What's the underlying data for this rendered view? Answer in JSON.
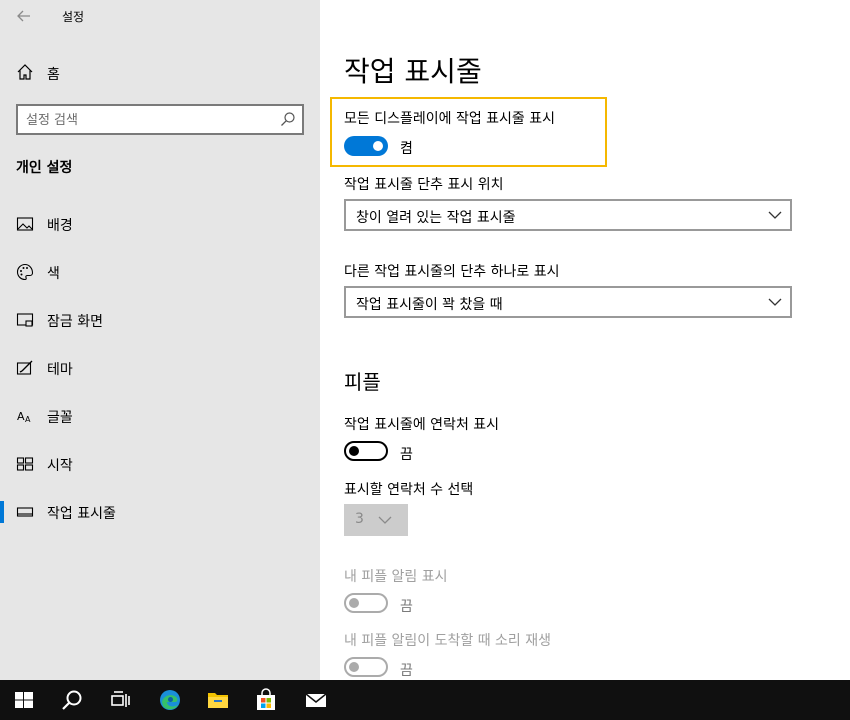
{
  "window": {
    "title": "설정"
  },
  "sidebar": {
    "home_label": "홈",
    "search_placeholder": "설정 검색",
    "section_label": "개인 설정",
    "items": [
      {
        "label": "배경",
        "icon": "picture-icon"
      },
      {
        "label": "색",
        "icon": "palette-icon"
      },
      {
        "label": "잠금 화면",
        "icon": "lock-screen-icon"
      },
      {
        "label": "테마",
        "icon": "theme-icon"
      },
      {
        "label": "글꼴",
        "icon": "font-icon"
      },
      {
        "label": "시작",
        "icon": "start-icon"
      },
      {
        "label": "작업 표시줄",
        "icon": "taskbar-icon",
        "active": true
      }
    ]
  },
  "main": {
    "title": "작업 표시줄",
    "all_displays": {
      "label": "모든 디스플레이에 작업 표시줄 표시",
      "state": "켬",
      "on": true
    },
    "button_position": {
      "label": "작업 표시줄 단추 표시 위치",
      "value": "창이 열려 있는 작업 표시줄"
    },
    "combine_buttons": {
      "label": "다른 작업 표시줄의 단추 하나로 표시",
      "value": "작업 표시줄이 꽉 찼을 때"
    },
    "people": {
      "heading": "피플",
      "show_contacts": {
        "label": "작업 표시줄에 연락처 표시",
        "state": "끔",
        "on": false
      },
      "contact_count": {
        "label": "표시할 연락처 수 선택",
        "value": "3"
      },
      "show_notifications": {
        "label": "내 피플 알림 표시",
        "state": "끔",
        "on": false,
        "disabled": true
      },
      "play_sound": {
        "label": "내 피플 알림이 도착할 때 소리 재생",
        "state": "끔",
        "on": false,
        "disabled": true
      }
    }
  },
  "taskbar": {
    "items": [
      "windows-start-icon",
      "search-icon",
      "task-view-icon",
      "edge-icon",
      "file-explorer-icon",
      "store-icon",
      "mail-icon"
    ]
  },
  "colors": {
    "accent": "#0078d7",
    "highlight": "#f5b800",
    "taskbar": "#101010",
    "sidebar": "#e6e6e6"
  }
}
